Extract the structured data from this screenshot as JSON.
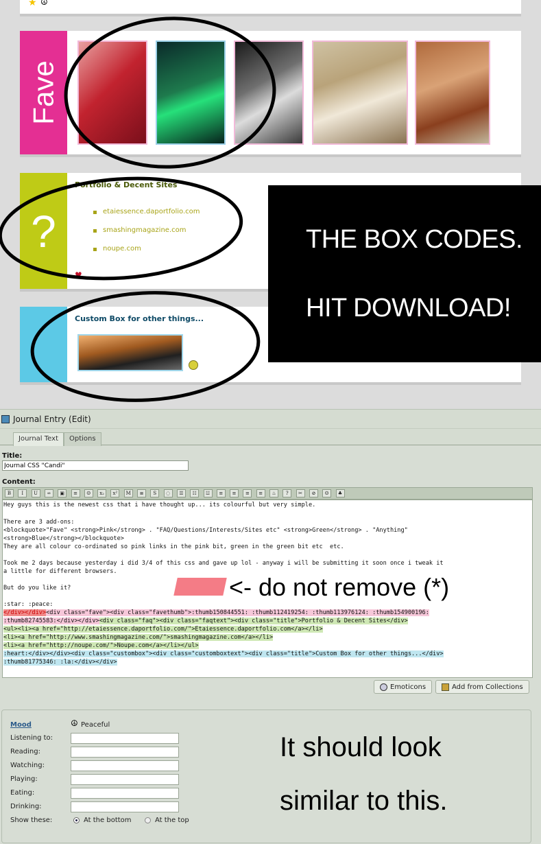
{
  "preview": {
    "fave_label": "Fave",
    "faq_symbol": "?",
    "faq_title": "Portfolio & Decent Sites",
    "sites": [
      "etaiessence.daportfolio.com",
      "smashingmagazine.com",
      "noupe.com"
    ],
    "custom_title": "Custom Box for other things...",
    "overlay_line1": "THE BOX CODES.",
    "overlay_line2": "HIT DOWNLOAD!"
  },
  "editor": {
    "header_title": "Journal Entry (Edit)",
    "tabs": [
      "Journal Text",
      "Options"
    ],
    "title_label": "Title:",
    "title_value": "Journal CSS \"Candi\"",
    "content_label": "Content:",
    "toolbar_buttons": [
      "B",
      "I",
      "U",
      "∞",
      "▣",
      "≡",
      "☺",
      "x₂",
      "x²",
      "M",
      "≣",
      "S",
      "◌",
      "☰",
      "☷",
      "☳",
      "≡",
      "≡",
      "≡",
      "≡",
      "♨",
      "?",
      "✂",
      "⊘",
      "☺",
      "♣"
    ],
    "text_lines": [
      "Hey guys this is the newest css that i have thought up... its colourful but very simple.",
      "",
      "There are 3 add-ons:",
      "<blockquote>\"Fave\" <strong>Pink</strong> . \"FAQ/Questions/Interests/Sites etc\" <strong>Green</strong> . \"Anything\"",
      "<strong>Blue</strong></blockquote>",
      "They are all colour co-ordinated so pink links in the pink bit, green in the green bit etc  etc.",
      "",
      "Took me 2 days because yesterday i did 3/4 of this css and gave up lol - anyway i will be submitting it soon once i tweak it",
      "a little for different browsers.",
      "",
      "But do you like it?"
    ],
    "code_line1_red": "</div></div>",
    "code_line1_rest": "<div class=\"fave\"><div class=\"favethumb\">:thumb150844551: :thumb112419254: :thumb113976124: :thumb154900196:",
    "code_line2_pink": ":thumb82745583:</div></div>",
    "code_line2_green": "<div class=\"faq\"><div class=\"faqtext\"><div class=\"title\">Portfolio & Decent Sites</div>",
    "code_line3": "<ul><li><a href=\"http://etaiessence.daportfolio.com/\">Etaiessence.daportfolio.com</a></li>",
    "code_line4": "<li><a href=\"http://www.smashingmagazine.com/\">smashingmagazine.com</a></li>",
    "code_line5": "<li><a href=\"http://noupe.com/\">Noupe.com</a></li></ul>",
    "code_line6": ":heart:</div></div><div class=\"custombox\"><div class=\"customboxtext\"><div class=\"title\">Custom Box for other things...</div>",
    "code_line7": ":thumb81775346: :la:</div></div>",
    "star_peace": ":star: :peace:",
    "annotation": "<- do not remove (*)",
    "emoticons_button": "Emoticons",
    "collections_button": "Add from Collections",
    "mood_label": "Mood",
    "mood_value": "Peaceful",
    "fields": [
      "Listening to:",
      "Reading:",
      "Watching:",
      "Playing:",
      "Eating:",
      "Drinking:"
    ],
    "show_these_label": "Show these:",
    "radio_bottom": "At the bottom",
    "radio_top": "At the top",
    "note_line1": "It should look",
    "note_line2": "similar to this."
  },
  "colors": {
    "pink": "#e42f93",
    "green": "#bfcb16",
    "blue": "#5cc9e6"
  }
}
